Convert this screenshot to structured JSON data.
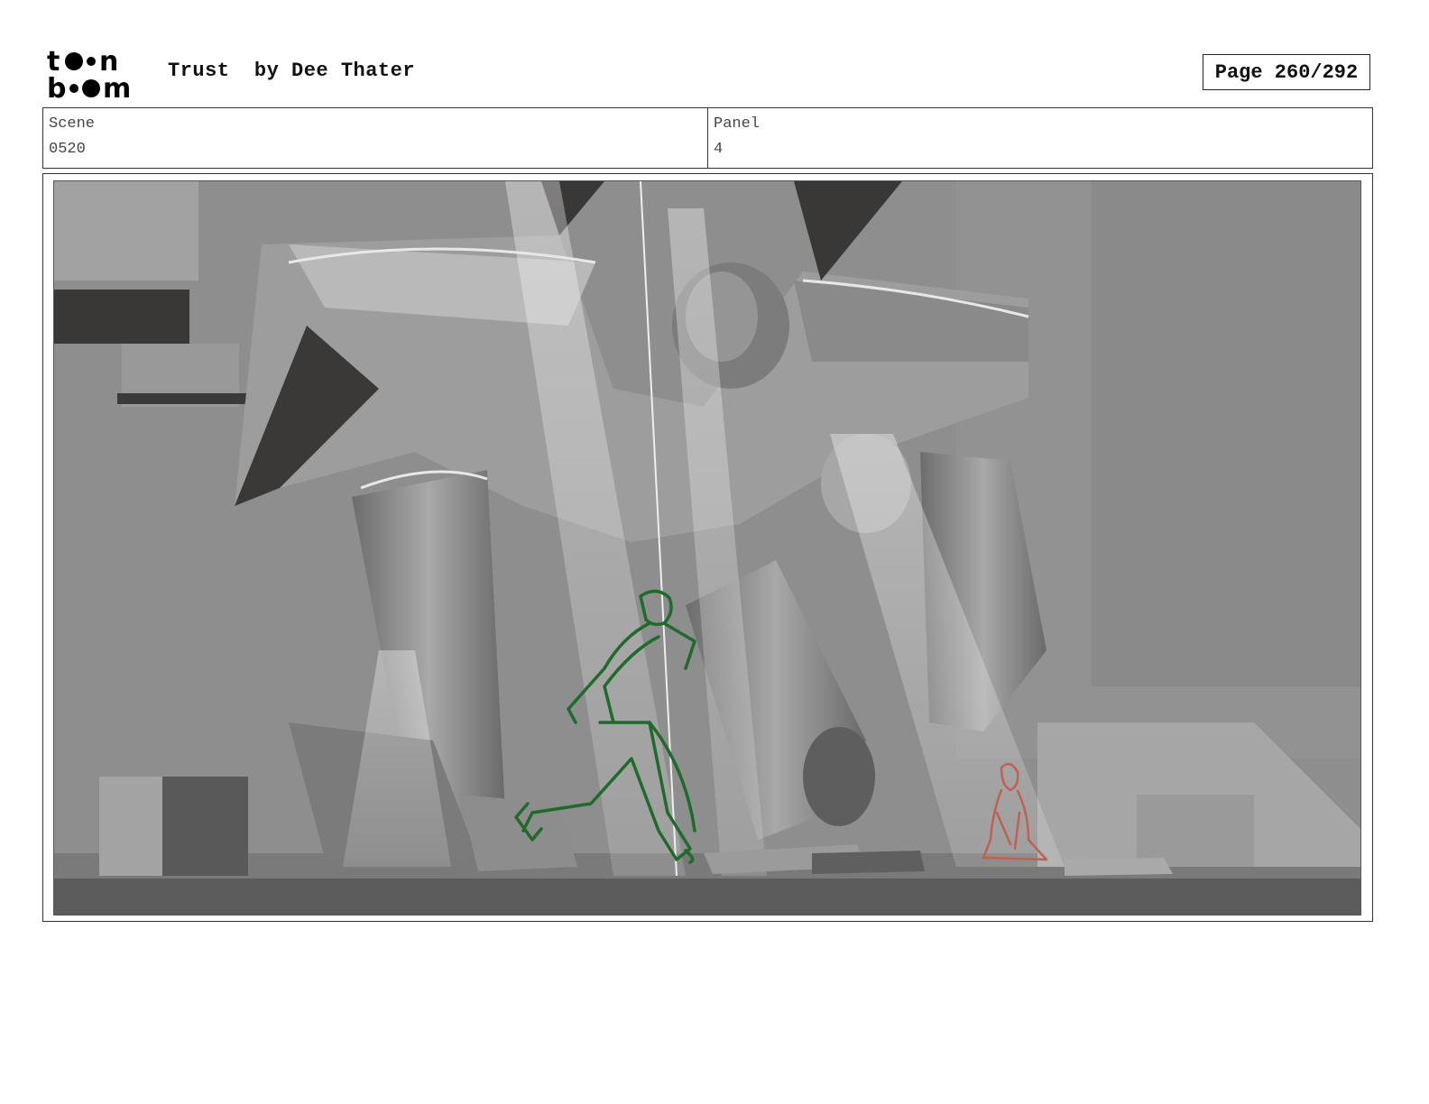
{
  "header": {
    "logo_text": "toon boom",
    "title": "Trust  by Dee Thater",
    "page_label": "Page 260/292"
  },
  "info": {
    "scene_label": "Scene",
    "scene_value": "0520",
    "panel_label": "Panel",
    "panel_value": "4"
  },
  "panel": {
    "description": "storyboard-panel-drawing",
    "colors": {
      "background": "#8d8d8d",
      "man_outline": "#1f6b2a",
      "girl_outline": "#c0614f"
    }
  }
}
